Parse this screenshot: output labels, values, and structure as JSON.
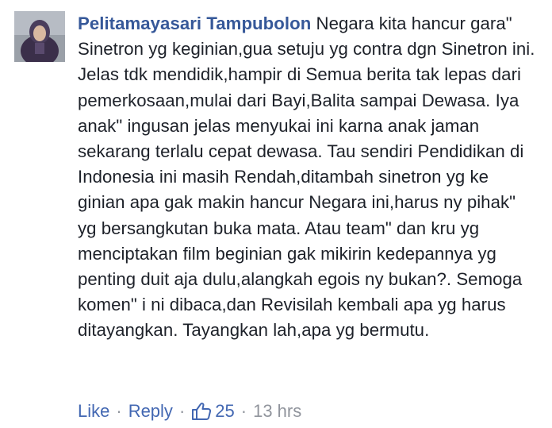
{
  "comment": {
    "author": "Pelitamayasari Tampubolon",
    "text": "Negara kita hancur gara\" Sinetron yg keginian,gua setuju yg contra dgn Sinetron ini. Jelas tdk mendidik,hampir di Semua berita tak lepas dari pemerkosaan,mulai dari Bayi,Balita sampai Dewasa. Iya anak\" ingusan jelas menyukai ini karna anak jaman sekarang terlalu cepat dewasa. Tau sendiri Pendidikan di Indonesia ini masih Rendah,ditambah sinetron yg ke ginian apa gak makin hancur Negara ini,harus ny pihak\" yg bersangkutan buka mata. Atau team\" dan kru yg menciptakan film beginian gak mikirin kedepannya yg penting duit aja dulu,alangkah egois ny bukan?. Semoga komen\" i ni dibaca,dan Revisilah kembali apa yg harus ditayangkan. Tayangkan lah,apa yg bermutu.",
    "like_label": "Like",
    "reply_label": "Reply",
    "separator": "·",
    "reaction_icon": "thumbs-up-icon",
    "reaction_count": "25",
    "timestamp": "13 hrs",
    "colors": {
      "author": "#365899",
      "link": "#4267b2",
      "text": "#1d2129",
      "meta": "#90949c"
    }
  }
}
